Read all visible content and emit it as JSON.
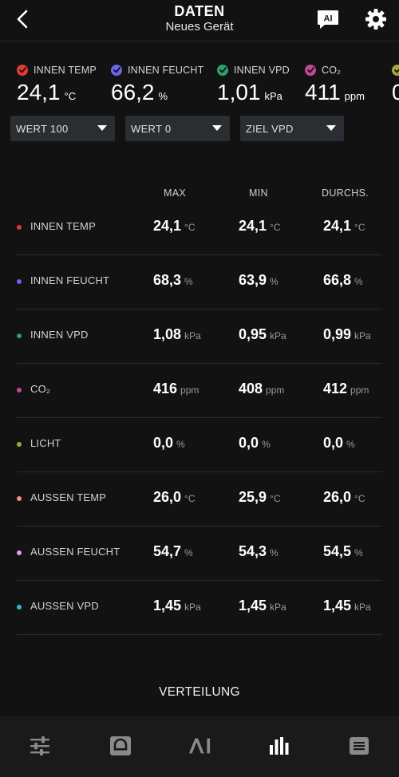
{
  "header": {
    "title": "DATEN",
    "subtitle": "Neues Gerät",
    "ai_badge": "AI"
  },
  "sensors": [
    {
      "label": "INNEN TEMP",
      "value": "24,1",
      "unit": "°C",
      "color": "#e53935"
    },
    {
      "label": "INNEN FEUCHT",
      "value": "66,2",
      "unit": "%",
      "color": "#6a67e6"
    },
    {
      "label": "INNEN VPD",
      "value": "1,01",
      "unit": "kPa",
      "color": "#2e9e6a"
    },
    {
      "label": "CO₂",
      "value": "411",
      "unit": "ppm",
      "color": "#c0479a"
    },
    {
      "label": "",
      "value": "0",
      "unit": "",
      "color": "#a6a534"
    }
  ],
  "dropdowns": [
    {
      "value": "WERT 100"
    },
    {
      "value": "WERT 0"
    },
    {
      "value": "ZIEL VPD"
    }
  ],
  "table": {
    "columns": [
      "MAX",
      "MIN",
      "DURCHS."
    ],
    "rows": [
      {
        "label": "INNEN TEMP",
        "color": "#e53935",
        "max": "24,1",
        "min": "24,1",
        "avg": "24,1",
        "unit": "°C"
      },
      {
        "label": "INNEN FEUCHT",
        "color": "#6a67e6",
        "max": "68,3",
        "min": "63,9",
        "avg": "66,8",
        "unit": "%"
      },
      {
        "label": "INNEN VPD",
        "color": "#2e9e6a",
        "max": "1,08",
        "min": "0,95",
        "avg": "0,99",
        "unit": "kPa"
      },
      {
        "label": "CO₂",
        "color": "#c0479a",
        "max": "416",
        "min": "408",
        "avg": "412",
        "unit": "ppm"
      },
      {
        "label": "LICHT",
        "color": "#a6a534",
        "max": "0,0",
        "min": "0,0",
        "avg": "0,0",
        "unit": "%"
      },
      {
        "label": "AUSSEN TEMP",
        "color": "#f0928a",
        "max": "26,0",
        "min": "25,9",
        "avg": "26,0",
        "unit": "°C"
      },
      {
        "label": "AUSSEN FEUCHT",
        "color": "#e3a0ef",
        "max": "54,7",
        "min": "54,3",
        "avg": "54,5",
        "unit": "%"
      },
      {
        "label": "AUSSEN VPD",
        "color": "#2cbfc9",
        "max": "1,45",
        "min": "1,45",
        "avg": "1,45",
        "unit": "kPa"
      }
    ]
  },
  "distribution_label": "VERTEILUNG",
  "bottom_nav": {
    "items": [
      {
        "icon": "sliders-icon",
        "active": false
      },
      {
        "icon": "device-icon",
        "active": false
      },
      {
        "icon": "ai-icon",
        "active": false
      },
      {
        "icon": "bar-chart-icon",
        "active": true
      },
      {
        "icon": "log-icon",
        "active": false
      }
    ],
    "active_color": "#ffffff",
    "inactive_color": "#8a8a8a"
  }
}
